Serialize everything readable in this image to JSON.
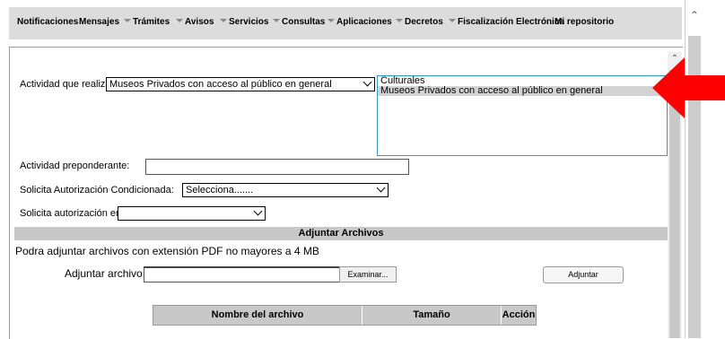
{
  "nav": {
    "items": [
      {
        "label": "Notificaciones",
        "dropdown": false
      },
      {
        "label": "Mensajes",
        "dropdown": false
      },
      {
        "label": "Trámites",
        "dropdown": true
      },
      {
        "label": "Avisos",
        "dropdown": true
      },
      {
        "label": "Servicios",
        "dropdown": true
      },
      {
        "label": "Consultas",
        "dropdown": true
      },
      {
        "label": "Aplicaciones",
        "dropdown": true
      },
      {
        "label": "Decretos",
        "dropdown": true
      },
      {
        "label": "Fiscalización Electrónica",
        "dropdown": true
      },
      {
        "label": "Mi repositorio",
        "dropdown": false
      }
    ]
  },
  "form": {
    "actividad_label": "Actividad que realiza:",
    "actividad_value": "Museos Privados con acceso al público en general",
    "actividad_list": [
      "Culturales",
      "Museos Privados con acceso al público en general"
    ],
    "actividad_list_selected_index": 1,
    "preponderante_label": "Actividad preponderante:",
    "preponderante_value": "",
    "condicionada_label": "Solicita Autorización Condicionada:",
    "condicionada_value": "Selecciona.......",
    "autorizacion_en_label": "Solicita autorización en:",
    "autorizacion_en_value": ""
  },
  "attachments": {
    "section_title": "Adjuntar Archivos",
    "note": "Podra adjuntar archivos con extensión PDF no mayores a 4 MB",
    "file_label": "Adjuntar archivo:",
    "browse_label": "Examinar...",
    "attach_button": "Adjuntar",
    "table_headers": [
      "Nombre del archivo",
      "Tamaño",
      "Acción"
    ]
  },
  "colors": {
    "arrow": "#ff0000",
    "nav_bg": "#dcdcdc",
    "section_bg": "#c8c8c8",
    "listbox_border": "#3399cc",
    "listbox_selected": "#d3d3d3"
  }
}
